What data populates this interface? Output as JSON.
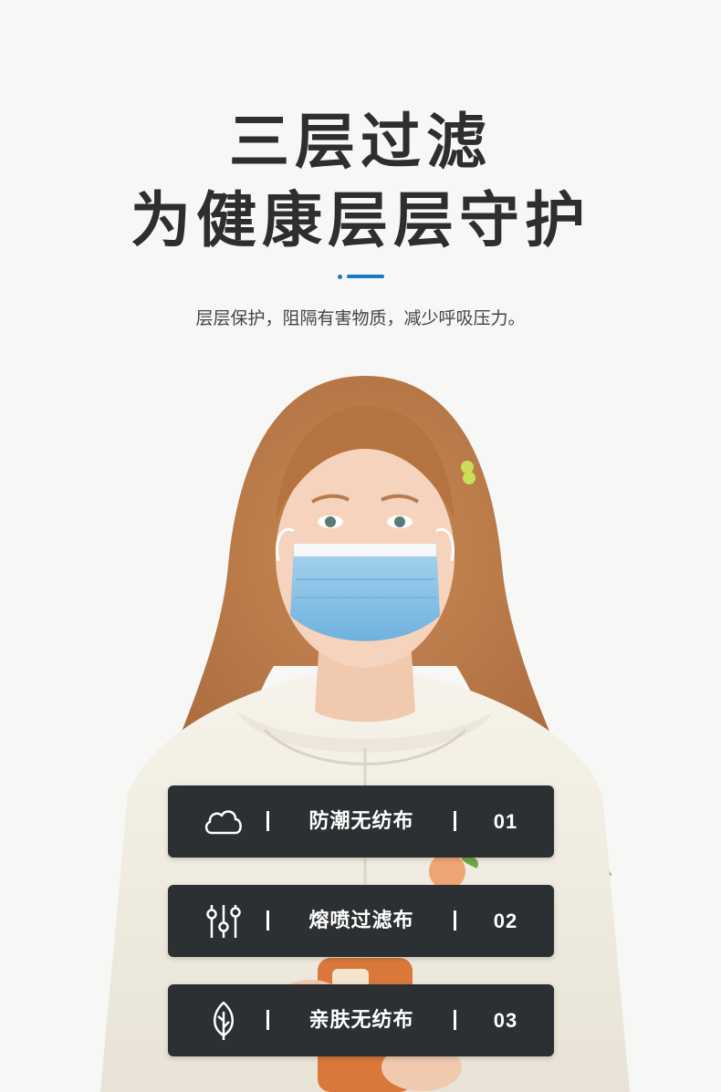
{
  "heading": {
    "line1": "三层过滤",
    "line2": "为健康层层守护",
    "subtitle": "层层保护，阻隔有害物质，减少呼吸压力。"
  },
  "colors": {
    "accent": "#1a79c4",
    "card_background": "#2c3033",
    "mask": "#8fc4e6"
  },
  "features": [
    {
      "icon": "cloud-icon",
      "name": "防潮无纺布",
      "number": "01"
    },
    {
      "icon": "sliders-icon",
      "name": "熔喷过滤布",
      "number": "02"
    },
    {
      "icon": "leaf-icon",
      "name": "亲肤无纺布",
      "number": "03"
    }
  ]
}
